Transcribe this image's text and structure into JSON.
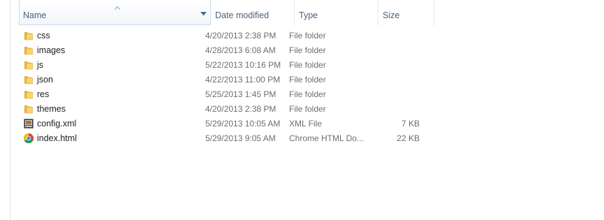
{
  "columns": {
    "name": "Name",
    "date_modified": "Date modified",
    "type": "Type",
    "size": "Size"
  },
  "sort": {
    "column": "name",
    "direction": "ascending"
  },
  "files": [
    {
      "name": "css",
      "date": "4/20/2013 2:38 PM",
      "type": "File folder",
      "size": "",
      "icon": "folder-icon"
    },
    {
      "name": "images",
      "date": "4/28/2013 6:08 AM",
      "type": "File folder",
      "size": "",
      "icon": "folder-icon"
    },
    {
      "name": "js",
      "date": "5/22/2013 10:16 PM",
      "type": "File folder",
      "size": "",
      "icon": "folder-icon"
    },
    {
      "name": "json",
      "date": "4/22/2013 11:00 PM",
      "type": "File folder",
      "size": "",
      "icon": "folder-icon"
    },
    {
      "name": "res",
      "date": "5/25/2013 1:45 PM",
      "type": "File folder",
      "size": "",
      "icon": "folder-icon"
    },
    {
      "name": "themes",
      "date": "4/20/2013 2:38 PM",
      "type": "File folder",
      "size": "",
      "icon": "folder-icon"
    },
    {
      "name": "config.xml",
      "date": "5/29/2013 10:05 AM",
      "type": "XML File",
      "size": "7 KB",
      "icon": "xml-file-icon"
    },
    {
      "name": "index.html",
      "date": "5/29/2013 9:05 AM",
      "type": "Chrome HTML Do...",
      "size": "22 KB",
      "icon": "chrome-html-icon"
    }
  ],
  "colors": {
    "header_text": "#4c607a",
    "secondary_text": "#6d6d6d",
    "folder_yellow": "#f3c74a"
  }
}
